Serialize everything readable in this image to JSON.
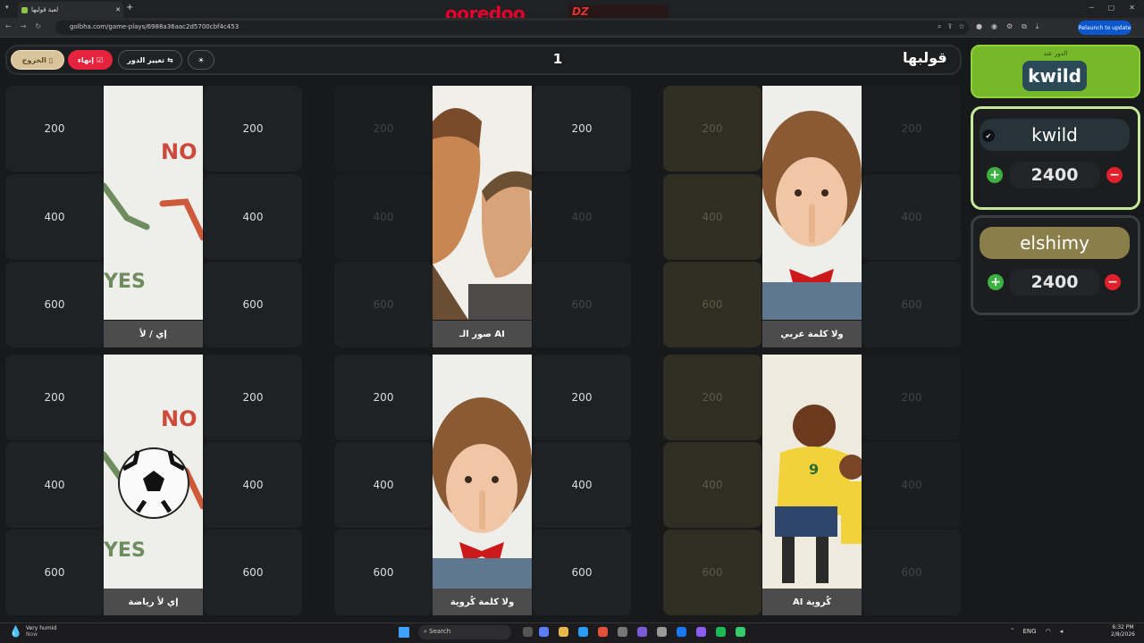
{
  "browser": {
    "tab_title": "لعبة قولبها",
    "url": "golbha.com/game-plays/6988a36aac2d5700cbf4c453",
    "relaunch_label": "Relaunch to update",
    "new_tab": "+",
    "tab_close": "✕"
  },
  "brand": {
    "name": "ooredoo",
    "partner": "DZ"
  },
  "header": {
    "logo": "قولبها",
    "round_number": "1",
    "exit_label": "الخروج",
    "end_label": "إنهاء",
    "swap_label": "تغيير الدور"
  },
  "board": {
    "categories": [
      {
        "label": "إي / لأ",
        "cells_left": [
          "200",
          "400",
          "600"
        ],
        "cells_right": [
          "200",
          "400",
          "600"
        ]
      },
      {
        "label": "صور الـ AI",
        "cells_left": [
          "200",
          "400",
          "600"
        ],
        "cells_right": [
          "200",
          "400",
          "600"
        ]
      },
      {
        "label": "ولا كلمة عربي",
        "cells_left": [
          "200",
          "400",
          "600"
        ],
        "cells_right": [
          "200",
          "400",
          "600"
        ]
      },
      {
        "label": "إي لأ رياضة",
        "cells_left": [
          "200",
          "400",
          "600"
        ],
        "cells_right": [
          "200",
          "400",
          "600"
        ]
      },
      {
        "label": "ولا كلمة كُروية",
        "cells_left": [
          "200",
          "400",
          "600"
        ],
        "cells_right": [
          "200",
          "400",
          "600"
        ]
      },
      {
        "label": "AI كُروية",
        "cells_left": [
          "200",
          "400",
          "600"
        ],
        "cells_right": [
          "200",
          "400",
          "600"
        ]
      }
    ],
    "img_text": {
      "no": "NO",
      "yes": "YES",
      "jersey": "9"
    }
  },
  "turn": {
    "label": "الدور عند",
    "player": "kwild"
  },
  "players": [
    {
      "name": "kwild",
      "score": "2400"
    },
    {
      "name": "elshimy",
      "score": "2400"
    }
  ],
  "taskbar": {
    "weather_title": "Very humid",
    "weather_sub": "Now",
    "search_placeholder": "Search",
    "lang": "ENG",
    "time": "6:32 PM",
    "date": "2/8/2026"
  },
  "colors": {
    "turn_bg": "#76b82a",
    "end_button": "#e5233f",
    "exit_button": "#d9c39b",
    "plus": "#3cb043",
    "minus": "#e0202a"
  }
}
